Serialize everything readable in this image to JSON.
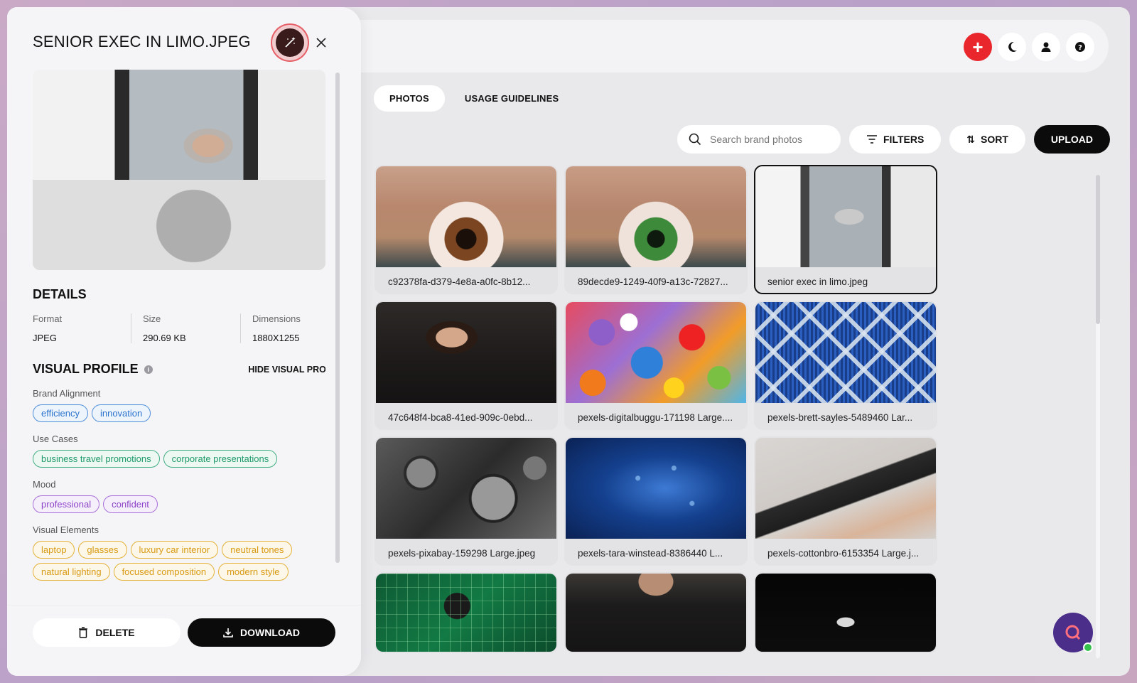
{
  "header": {
    "add_icon": "plus-icon",
    "theme_icon": "moon-icon",
    "profile_icon": "user-icon",
    "help_icon": "help-icon"
  },
  "tabs": [
    {
      "label": "PHOTOS",
      "active": true
    },
    {
      "label": "USAGE GUIDELINES",
      "active": false
    }
  ],
  "toolbar": {
    "search_placeholder": "Search brand photos",
    "filters_label": "FILTERS",
    "sort_label": "SORT",
    "upload_label": "UPLOAD"
  },
  "photos": [
    {
      "caption": "c92378fa-d379-4e8a-a0fc-8b12...",
      "selected": false
    },
    {
      "caption": "89decde9-1249-40f9-a13c-72827...",
      "selected": false
    },
    {
      "caption": "senior exec in limo.jpeg",
      "selected": true
    },
    {
      "caption": "47c648f4-bca8-41ed-909c-0ebd...",
      "selected": false
    },
    {
      "caption": "pexels-digitalbuggu-171198 Large....",
      "selected": false
    },
    {
      "caption": "pexels-brett-sayles-5489460 Lar...",
      "selected": false
    },
    {
      "caption": "pexels-pixabay-159298 Large.jpeg",
      "selected": false
    },
    {
      "caption": "pexels-tara-winstead-8386440 L...",
      "selected": false
    },
    {
      "caption": "pexels-cottonbro-6153354 Large.j...",
      "selected": false
    }
  ],
  "drawer": {
    "title": "SENIOR EXEC IN LIMO.JPEG",
    "details_title": "DETAILS",
    "details": [
      {
        "label": "Format",
        "value": "JPEG"
      },
      {
        "label": "Size",
        "value": "290.69 KB"
      },
      {
        "label": "Dimensions",
        "value": "1880X1255"
      }
    ],
    "visual_profile_title": "VISUAL PROFILE",
    "hide_visual_profile": "HIDE VISUAL PROFI",
    "groups": {
      "brand_alignment": {
        "label": "Brand Alignment",
        "tags": [
          "efficiency",
          "innovation"
        ]
      },
      "use_cases": {
        "label": "Use Cases",
        "tags": [
          "business travel promotions",
          "corporate presentations"
        ]
      },
      "mood": {
        "label": "Mood",
        "tags": [
          "professional",
          "confident"
        ]
      },
      "visual_elements": {
        "label": "Visual Elements",
        "tags": [
          "laptop",
          "glasses",
          "luxury car interior",
          "neutral tones",
          "natural lighting",
          "focused composition",
          "modern style"
        ]
      }
    },
    "delete_label": "DELETE",
    "download_label": "DOWNLOAD"
  },
  "colors": {
    "accent_red": "#e8262b",
    "primary_dark": "#0b0b0b",
    "tag_blue": "#2a73cc",
    "tag_green": "#1f9a6a",
    "tag_purple": "#8c45c8",
    "tag_yellow": "#d89a12"
  }
}
